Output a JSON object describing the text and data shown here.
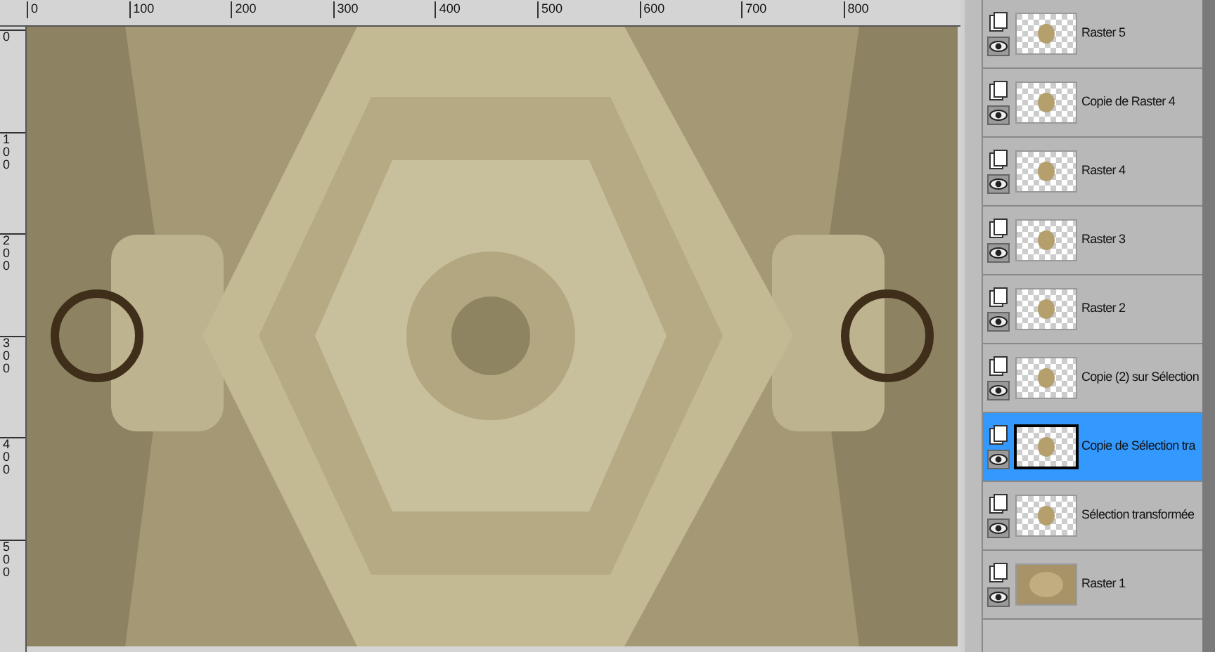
{
  "ruler_top": {
    "labels": [
      "0",
      "100",
      "200",
      "300",
      "400",
      "500",
      "600",
      "700",
      "800"
    ]
  },
  "ruler_left": {
    "labels": [
      "0",
      "100",
      "200",
      "300",
      "400",
      "500"
    ]
  },
  "layers": [
    {
      "name": "Raster 5",
      "visible": true,
      "selected": false,
      "transparent": true
    },
    {
      "name": "Copie de Raster 4",
      "visible": true,
      "selected": false,
      "transparent": true
    },
    {
      "name": "Raster 4",
      "visible": true,
      "selected": false,
      "transparent": true
    },
    {
      "name": "Raster 3",
      "visible": true,
      "selected": false,
      "transparent": true
    },
    {
      "name": "Raster 2",
      "visible": true,
      "selected": false,
      "transparent": true
    },
    {
      "name": "Copie (2) sur Sélection",
      "visible": true,
      "selected": false,
      "transparent": true
    },
    {
      "name": "Copie de Sélection tra",
      "visible": true,
      "selected": true,
      "transparent": true
    },
    {
      "name": "Sélection transformée",
      "visible": true,
      "selected": false,
      "transparent": true
    },
    {
      "name": "Raster 1",
      "visible": true,
      "selected": false,
      "transparent": false
    }
  ]
}
